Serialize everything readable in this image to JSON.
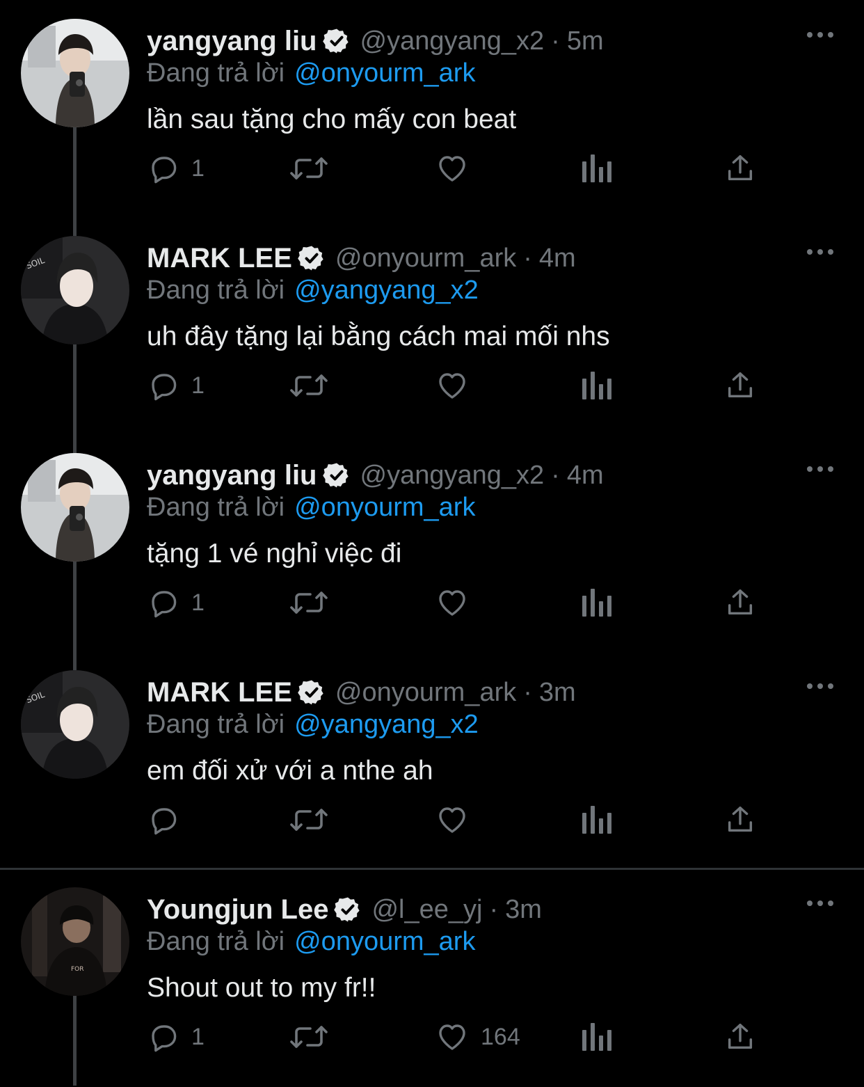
{
  "colors": {
    "background": "#000000",
    "text": "#e7e9ea",
    "muted": "#71767b",
    "link": "#1d9bf0",
    "verified": "#e7e9ea"
  },
  "reply_label": "Đang trả lời",
  "tweets": [
    {
      "name": "yangyang liu",
      "handle": "@yangyang_x2",
      "time": "5m",
      "replying_to": "@onyourm_ark",
      "text": "lần sau tặng cho mấy con beat",
      "reply_count": "1",
      "like_count": "",
      "avatar": "yangyang-avatar"
    },
    {
      "name": "MARK LEE",
      "handle": "@onyourm_ark",
      "time": "4m",
      "replying_to": "@yangyang_x2",
      "text": "uh đây tặng lại bằng cách mai mối nhs",
      "reply_count": "1",
      "like_count": "",
      "avatar": "marklee-avatar"
    },
    {
      "name": "yangyang liu",
      "handle": "@yangyang_x2",
      "time": "4m",
      "replying_to": "@onyourm_ark",
      "text": "tặng 1 vé nghỉ việc đi",
      "reply_count": "1",
      "like_count": "",
      "avatar": "yangyang-avatar"
    },
    {
      "name": "MARK LEE",
      "handle": "@onyourm_ark",
      "time": "3m",
      "replying_to": "@yangyang_x2",
      "text": "em đối xử với a nthe ah",
      "reply_count": "",
      "like_count": "",
      "avatar": "marklee-avatar"
    },
    {
      "name": "Youngjun Lee",
      "handle": "@l_ee_yj",
      "time": "3m",
      "replying_to": "@onyourm_ark",
      "text": "Shout out to my fr!!",
      "reply_count": "1",
      "like_count": "164",
      "avatar": "youngjun-avatar"
    }
  ],
  "icons": {
    "reply": "reply-icon",
    "retweet": "retweet-icon",
    "like": "heart-icon",
    "views": "analytics-icon",
    "share": "share-icon",
    "more": "more-icon",
    "verified": "verified-badge-icon"
  }
}
